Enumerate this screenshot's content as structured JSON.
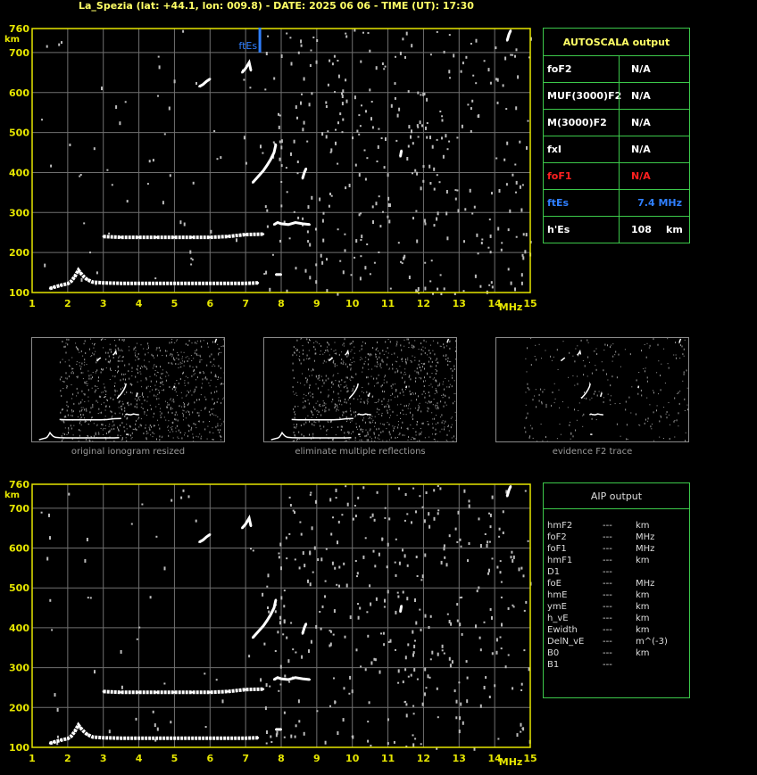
{
  "header": {
    "title": "La_Spezia (lat: +44.1, lon: 009.8) - DATE: 2025 06 06 - TIME (UT): 17:30"
  },
  "colors": {
    "axis": "#e6e600",
    "grid": "#707070",
    "trace": "#ffffff",
    "noise": "#bdbdbd",
    "panel_border": "#3cc84a",
    "label_yellow": "#ffff66",
    "fte_blue": "#2f7fff",
    "fof1_red": "#ff2020"
  },
  "chart_data": [
    {
      "type": "scatter",
      "title": "",
      "xlabel": "MHz",
      "ylabel": "km",
      "xlim": [
        1,
        15
      ],
      "ylim": [
        100,
        760
      ],
      "x_ticks": [
        1,
        2,
        3,
        4,
        5,
        6,
        7,
        8,
        9,
        10,
        11,
        12,
        13,
        14,
        15
      ],
      "y_ticks": [
        100,
        200,
        300,
        400,
        500,
        600,
        700,
        760
      ],
      "grid": true,
      "series": [
        {
          "points": [
            [
              1.5,
              110
            ],
            [
              1.6,
              113
            ],
            [
              1.8,
              118
            ],
            [
              2.0,
              122
            ],
            [
              2.1,
              128
            ],
            [
              2.2,
              140
            ],
            [
              2.3,
              156
            ],
            [
              2.35,
              150
            ],
            [
              2.45,
              140
            ],
            [
              2.55,
              132
            ],
            [
              2.7,
              126
            ],
            [
              3.0,
              124
            ],
            [
              3.5,
              123
            ],
            [
              4.0,
              123
            ],
            [
              4.5,
              123
            ],
            [
              5.0,
              123
            ],
            [
              5.5,
              123
            ],
            [
              6.0,
              123
            ],
            [
              6.5,
              123
            ],
            [
              7.0,
              123
            ],
            [
              7.35,
              124
            ]
          ]
        },
        {
          "points": [
            [
              3.0,
              240
            ],
            [
              3.5,
              238
            ],
            [
              4.0,
              238
            ],
            [
              4.5,
              238
            ],
            [
              5.0,
              238
            ],
            [
              5.5,
              238
            ],
            [
              6.0,
              238
            ],
            [
              6.5,
              240
            ],
            [
              7.0,
              245
            ],
            [
              7.5,
              246
            ]
          ]
        },
        {
          "points": [
            [
              7.2,
              375
            ],
            [
              7.3,
              385
            ],
            [
              7.4,
              395
            ],
            [
              7.5,
              405
            ],
            [
              7.6,
              418
            ],
            [
              7.7,
              432
            ],
            [
              7.8,
              450
            ],
            [
              7.85,
              470
            ]
          ]
        },
        {
          "points": [
            [
              6.9,
              650
            ],
            [
              7.0,
              660
            ],
            [
              7.1,
              675
            ],
            [
              7.15,
              655
            ]
          ]
        },
        {
          "points": [
            [
              5.7,
              615
            ],
            [
              5.8,
              620
            ],
            [
              5.9,
              628
            ],
            [
              6.0,
              634
            ]
          ]
        },
        {
          "points": [
            [
              7.8,
              270
            ],
            [
              7.9,
              275
            ],
            [
              8.0,
              272
            ],
            [
              8.2,
              270
            ],
            [
              8.4,
              275
            ],
            [
              8.6,
              272
            ],
            [
              8.8,
              270
            ]
          ]
        },
        {
          "points": [
            [
              7.85,
              145
            ],
            [
              8.0,
              145
            ]
          ]
        },
        {
          "points": [
            [
              8.6,
              385
            ],
            [
              8.65,
              400
            ],
            [
              8.7,
              410
            ]
          ]
        },
        {
          "points": [
            [
              11.35,
              440
            ],
            [
              11.38,
              455
            ]
          ]
        },
        {
          "points": [
            [
              14.35,
              730
            ],
            [
              14.4,
              745
            ],
            [
              14.45,
              755
            ]
          ]
        }
      ],
      "annotations": [
        {
          "text": "ftEs",
          "x": 7.4,
          "y": 700
        }
      ]
    },
    {
      "type": "scatter",
      "title": "",
      "xlabel": "MHz",
      "ylabel": "km",
      "xlim": [
        1,
        15
      ],
      "ylim": [
        100,
        760
      ],
      "x_ticks": [
        1,
        2,
        3,
        4,
        5,
        6,
        7,
        8,
        9,
        10,
        11,
        12,
        13,
        14,
        15
      ],
      "y_ticks": [
        100,
        200,
        300,
        400,
        500,
        600,
        700,
        760
      ],
      "grid": true,
      "series": [
        {
          "points": [
            [
              1.5,
              110
            ],
            [
              1.6,
              113
            ],
            [
              1.8,
              118
            ],
            [
              2.0,
              122
            ],
            [
              2.1,
              128
            ],
            [
              2.2,
              140
            ],
            [
              2.3,
              156
            ],
            [
              2.35,
              150
            ],
            [
              2.45,
              140
            ],
            [
              2.55,
              132
            ],
            [
              2.7,
              126
            ],
            [
              3.0,
              124
            ],
            [
              3.5,
              123
            ],
            [
              4.0,
              123
            ],
            [
              4.5,
              123
            ],
            [
              5.0,
              123
            ],
            [
              5.5,
              123
            ],
            [
              6.0,
              123
            ],
            [
              6.5,
              123
            ],
            [
              7.0,
              123
            ],
            [
              7.35,
              124
            ]
          ]
        },
        {
          "points": [
            [
              3.0,
              240
            ],
            [
              3.5,
              238
            ],
            [
              4.0,
              238
            ],
            [
              4.5,
              238
            ],
            [
              5.0,
              238
            ],
            [
              5.5,
              238
            ],
            [
              6.0,
              238
            ],
            [
              6.5,
              240
            ],
            [
              7.0,
              245
            ],
            [
              7.5,
              246
            ]
          ]
        },
        {
          "points": [
            [
              7.2,
              375
            ],
            [
              7.3,
              385
            ],
            [
              7.4,
              395
            ],
            [
              7.5,
              405
            ],
            [
              7.6,
              418
            ],
            [
              7.7,
              432
            ],
            [
              7.8,
              450
            ],
            [
              7.85,
              470
            ]
          ]
        },
        {
          "points": [
            [
              6.9,
              650
            ],
            [
              7.0,
              660
            ],
            [
              7.1,
              675
            ],
            [
              7.15,
              655
            ]
          ]
        },
        {
          "points": [
            [
              5.7,
              615
            ],
            [
              5.8,
              620
            ],
            [
              5.9,
              628
            ],
            [
              6.0,
              634
            ]
          ]
        },
        {
          "points": [
            [
              7.8,
              270
            ],
            [
              7.9,
              275
            ],
            [
              8.0,
              272
            ],
            [
              8.2,
              270
            ],
            [
              8.4,
              275
            ],
            [
              8.6,
              272
            ],
            [
              8.8,
              270
            ]
          ]
        },
        {
          "points": [
            [
              7.85,
              145
            ],
            [
              8.0,
              145
            ]
          ]
        },
        {
          "points": [
            [
              8.6,
              385
            ],
            [
              8.65,
              400
            ],
            [
              8.7,
              410
            ]
          ]
        },
        {
          "points": [
            [
              11.35,
              440
            ],
            [
              11.38,
              455
            ]
          ]
        },
        {
          "points": [
            [
              14.35,
              730
            ],
            [
              14.4,
              745
            ],
            [
              14.45,
              755
            ]
          ]
        }
      ],
      "annotations": []
    }
  ],
  "autoscala": {
    "title": "AUTOSCALA output",
    "rows": [
      {
        "label": "foF2",
        "value": "N/A",
        "color": "#ffffff"
      },
      {
        "label": "MUF(3000)F2",
        "value": "N/A",
        "color": "#ffffff"
      },
      {
        "label": "M(3000)F2",
        "value": "N/A",
        "color": "#ffffff"
      },
      {
        "label": "fxI",
        "value": "N/A",
        "color": "#ffffff"
      },
      {
        "label": "foF1",
        "value": "N/A",
        "color": "#ff2020"
      },
      {
        "label": "ftEs",
        "value": "7.4 MHz",
        "color": "#2f7fff"
      },
      {
        "label": "h'Es",
        "value": "108",
        "unit": "km",
        "color": "#ffffff"
      }
    ]
  },
  "thumbnails": [
    {
      "caption": "original ionogram resized"
    },
    {
      "caption": "eliminate multiple reflections"
    },
    {
      "caption": "evidence F2 trace"
    }
  ],
  "aip": {
    "title": "AIP output",
    "rows": [
      {
        "param": "hmF2",
        "value": "---",
        "unit": "km"
      },
      {
        "param": "foF2",
        "value": "---",
        "unit": "MHz"
      },
      {
        "param": "foF1",
        "value": "---",
        "unit": "MHz"
      },
      {
        "param": "hmF1",
        "value": "---",
        "unit": "km"
      },
      {
        "param": "D1",
        "value": "---",
        "unit": ""
      },
      {
        "param": "foE",
        "value": "---",
        "unit": "MHz"
      },
      {
        "param": "hmE",
        "value": "---",
        "unit": "km"
      },
      {
        "param": "ymE",
        "value": "---",
        "unit": "km"
      },
      {
        "param": "h_vE",
        "value": "---",
        "unit": "km"
      },
      {
        "param": "Ewidth",
        "value": "---",
        "unit": "km"
      },
      {
        "param": "DelN_vE",
        "value": "---",
        "unit": "m^(-3)"
      },
      {
        "param": "B0",
        "value": "---",
        "unit": "km"
      },
      {
        "param": "B1",
        "value": "---",
        "unit": ""
      }
    ]
  }
}
